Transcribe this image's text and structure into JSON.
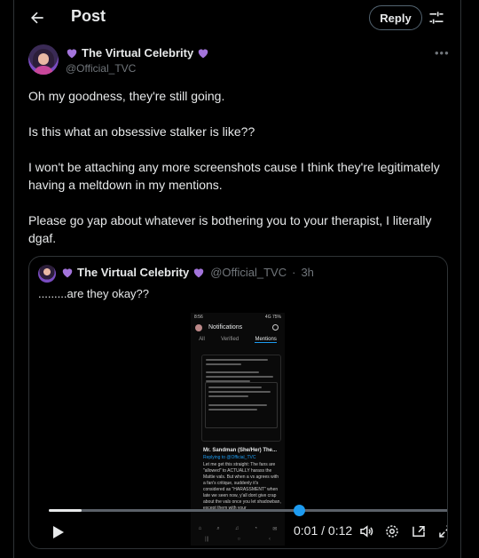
{
  "header": {
    "title": "Post",
    "reply_label": "Reply"
  },
  "post": {
    "display_name": "The Virtual Celebrity",
    "handle": "@Official_TVC",
    "paragraphs": [
      "Oh my goodness, they're still going.",
      "Is this what an obsessive stalker is like??",
      "I won't be attaching any more screenshots cause I think they're legitimately having a meltdown in my mentions.",
      "Please go yap about whatever is bothering you to your therapist, I literally dgaf."
    ]
  },
  "quote": {
    "display_name": "The Virtual Celebrity",
    "handle": "@Official_TVC",
    "time": "3h",
    "text": ".........are they okay??",
    "screenshot": {
      "status_time": "8:56",
      "status_right": "4G 75%",
      "title": "Notifications",
      "tabs": [
        "All",
        "Verified",
        "Mentions"
      ],
      "reply_name": "Mr. Sandman (She/Her) The...",
      "reply_to": "Replying to @Official_TVC",
      "reply_text": "Let me get this straight: The fans are \"allowed\" to ACTUALLY harass the Mattie  vals. But when a vs agrees with a fan's critique, suddenly it's considered as \"HARASSMENT\" when late we seen now, y'all dont give crap about the vals once you let shadowban, except them with your",
      "nav_row": [
        "⌂",
        "⌕",
        "♫",
        "◔",
        "✉"
      ],
      "nav_row2": [
        "|||",
        "○",
        "‹"
      ]
    }
  },
  "video": {
    "time_current": "0:01",
    "time_total": "0:12",
    "time_sep": " / ",
    "progress_fraction": 0.08
  },
  "colors": {
    "accent": "#1d9bf0",
    "heart": "#a374db",
    "muted": "#71767b"
  }
}
